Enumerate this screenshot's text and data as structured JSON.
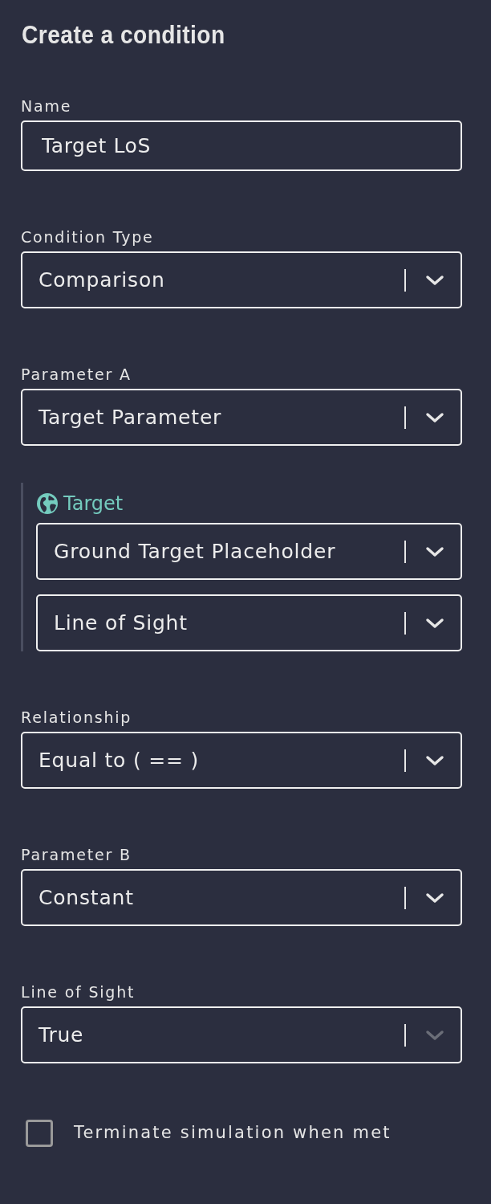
{
  "title": "Create a condition",
  "fields": [
    {
      "kind": "text",
      "label": "Name",
      "value": "Target LoS"
    },
    {
      "kind": "select",
      "label": "Condition Type",
      "value": "Comparison",
      "chevron_disabled": false
    },
    {
      "kind": "select",
      "label": "Parameter A",
      "value": "Target Parameter",
      "chevron_disabled": false
    },
    {
      "kind": "group",
      "heading": "Target",
      "selects": [
        {
          "value": "Ground Target Placeholder",
          "chevron_disabled": false
        },
        {
          "value": "Line of Sight",
          "chevron_disabled": false
        }
      ]
    },
    {
      "kind": "select",
      "label": "Relationship",
      "value": "Equal to ( == )",
      "chevron_disabled": false
    },
    {
      "kind": "select",
      "label": "Parameter B",
      "value": "Constant",
      "chevron_disabled": false
    },
    {
      "kind": "select",
      "label": "Line of Sight",
      "value": "True",
      "chevron_disabled": true
    }
  ],
  "checkbox": {
    "label": "Terminate simulation when met",
    "checked": false
  }
}
